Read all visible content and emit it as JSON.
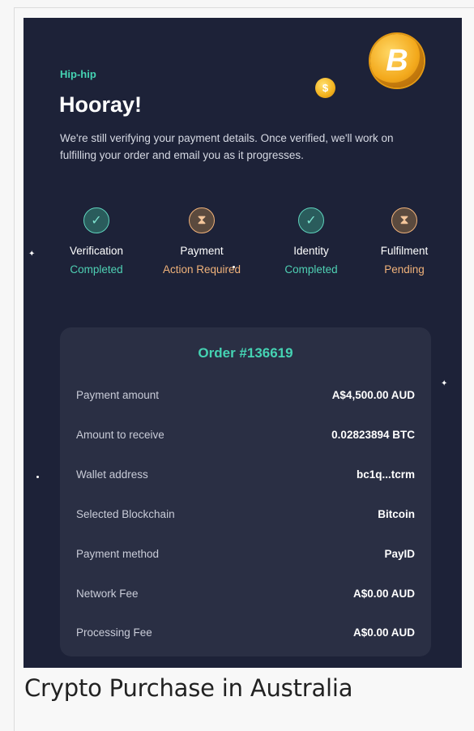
{
  "eyebrow": "Hip-hip",
  "headline": "Hooray!",
  "description": "We're still verifying your payment details. Once verified, we'll work on fulfilling your order and email you as it progresses.",
  "steps": [
    {
      "label": "Verification",
      "status": "Completed",
      "state": "done"
    },
    {
      "label": "Payment",
      "status": "Action Required",
      "state": "pending"
    },
    {
      "label": "Identity",
      "status": "Completed",
      "state": "done"
    },
    {
      "label": "Fulfilment",
      "status": "Pending",
      "state": "pending"
    }
  ],
  "order": {
    "title": "Order #136619",
    "rows": [
      {
        "label": "Payment amount",
        "value": "A$4,500.00 AUD"
      },
      {
        "label": "Amount to receive",
        "value": "0.02823894 BTC"
      },
      {
        "label": "Wallet address",
        "value": "bc1q...tcrm"
      },
      {
        "label": "Selected Blockchain",
        "value": "Bitcoin"
      },
      {
        "label": "Payment method",
        "value": "PayID"
      },
      {
        "label": "Network Fee",
        "value": "A$0.00 AUD"
      },
      {
        "label": "Processing Fee",
        "value": "A$0.00 AUD"
      }
    ]
  },
  "caption": "Crypto Purchase in Australia",
  "icons": {
    "coin_big": "bitcoin-coin-icon",
    "coin_small": "dollar-coin-icon",
    "done": "check-icon",
    "pending": "hourglass-icon"
  },
  "colors": {
    "background": "#1d2238",
    "card": "#2a2f44",
    "accent_teal": "#45d3b3",
    "accent_orange": "#f0b27a"
  }
}
